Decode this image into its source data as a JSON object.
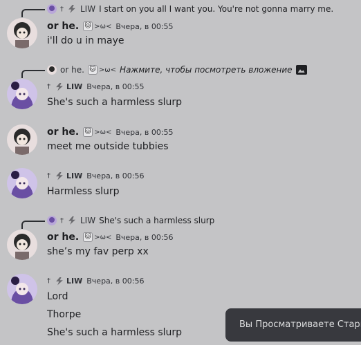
{
  "messages": [
    {
      "reply": {
        "name": "LIW",
        "text": "I start on you all I want you. You're not gonna marry me."
      },
      "author": "or he.",
      "badge": "🐱>ω<",
      "time": "Вчера, в 00:55",
      "lines": [
        "i'll do u in maye"
      ]
    },
    {
      "reply": {
        "name": "or he.",
        "badge": ">ω<",
        "text": "Нажмите, чтобы посмотреть вложение"
      },
      "author": "LIW",
      "time": "Вчера, в 00:55",
      "lines": [
        "She's such a harmless slurp"
      ]
    },
    {
      "author": "or he.",
      "badge": ">ω<",
      "time": "Вчера, в 00:55",
      "lines": [
        "meet me outside tubbies"
      ]
    },
    {
      "author": "LIW",
      "time": "Вчера, в 00:56",
      "lines": [
        "Harmless slurp"
      ]
    },
    {
      "reply": {
        "name": "LIW",
        "text": "She's such a harmless slurp"
      },
      "author": "or he.",
      "badge": ">ω<",
      "time": "Вчера, в 00:56",
      "lines": [
        "she’s my fav perp xx"
      ]
    },
    {
      "author": "LIW",
      "time": "Вчера, в 00:56",
      "lines": [
        "Lord",
        "Thorpe",
        "She's such a harmless slurp"
      ]
    }
  ],
  "toast": {
    "text": "Вы Просматриваете Старые"
  },
  "colors": {
    "background": "#c4c4c6",
    "toast": "#38393e"
  },
  "icons": [
    "dagger-icon",
    "bolt-icon",
    "cat-badge-icon",
    "image-icon"
  ]
}
